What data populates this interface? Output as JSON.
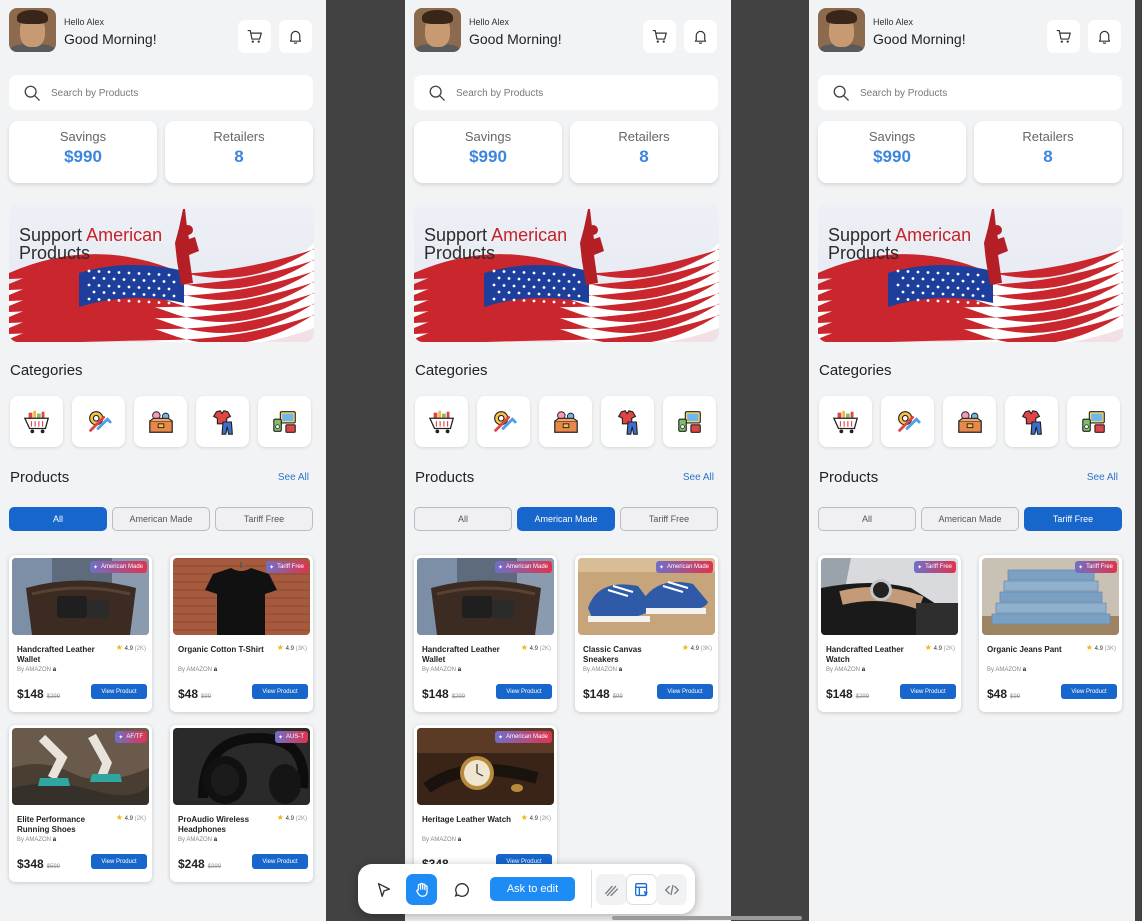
{
  "common": {
    "hello": "Hello Alex",
    "greeting": "Good Morning!",
    "search_placeholder": "Search by Products",
    "savings_label": "Savings",
    "savings_value": "$990",
    "retailers_label": "Retailers",
    "retailers_value": "8",
    "banner_line1_a": "Support ",
    "banner_line1_b": "American",
    "banner_line2": "Products",
    "categories_title": "Categories",
    "products_title": "Products",
    "see_all": "See All",
    "filters": [
      "All",
      "American Made",
      "Tariff Free"
    ],
    "view_product": "View Product",
    "by_label": "By AMAZON",
    "star": "★"
  },
  "categories": [
    {
      "icon": "grocery-cart-icon"
    },
    {
      "icon": "tools-icon"
    },
    {
      "icon": "toys-box-icon"
    },
    {
      "icon": "clothing-icon"
    },
    {
      "icon": "electronics-icon"
    }
  ],
  "screens": [
    {
      "active_filter": "All",
      "products": [
        {
          "name": "Handcrafted Leather Wallet",
          "badge": "American Made",
          "rating": "4.9",
          "count": "(2K)",
          "price": "$148",
          "old": "$299",
          "image": "bag"
        },
        {
          "name": "Organic Cotton T-Shirt",
          "badge": "Tariff Free",
          "rating": "4.9",
          "count": "(3K)",
          "price": "$48",
          "old": "$99",
          "image": "tshirt"
        },
        {
          "name": "Elite Performance Running Shoes",
          "badge": "AF/TF",
          "rating": "4.9",
          "count": "(2K)",
          "price": "$348",
          "old": "$599",
          "image": "running"
        },
        {
          "name": "ProAudio Wireless Headphones",
          "badge": "AUS-T",
          "rating": "4.9",
          "count": "(2K)",
          "price": "$248",
          "old": "$399",
          "image": "headphones"
        }
      ]
    },
    {
      "active_filter": "American Made",
      "products": [
        {
          "name": "Handcrafted Leather Wallet",
          "badge": "American Made",
          "rating": "4.9",
          "count": "(2K)",
          "price": "$148",
          "old": "$299",
          "image": "bag"
        },
        {
          "name": "Classic Canvas Sneakers",
          "badge": "American Made",
          "rating": "4.9",
          "count": "(3K)",
          "price": "$148",
          "old": "$99",
          "image": "sneakers"
        },
        {
          "name": "Heritage Leather Watch",
          "badge": "American Made",
          "rating": "4.9",
          "count": "(2K)",
          "price": "$348",
          "old": "",
          "image": "watch"
        }
      ]
    },
    {
      "active_filter": "Tariff Free",
      "products": [
        {
          "name": "Handcrafted Leather Watch",
          "badge": "Tariff Free",
          "rating": "4.9",
          "count": "(2K)",
          "price": "$148",
          "old": "$299",
          "image": "wristwatch"
        },
        {
          "name": "Organic Jeans Pant",
          "badge": "Tariff Free",
          "rating": "4.9",
          "count": "(3K)",
          "price": "$48",
          "old": "$99",
          "image": "jeans"
        }
      ]
    }
  ],
  "toolbar": {
    "ask_label": "Ask to edit",
    "tools": [
      "pointer-icon",
      "hand-icon",
      "comment-icon",
      "draw-icon",
      "layout-icon",
      "code-icon"
    ]
  },
  "colors": {
    "accent": "#1766cc",
    "stat_value": "#3c86df",
    "banner_red": "#c62229",
    "badge_gradient_start": "#6f6fc8",
    "badge_gradient_end": "#e0334e"
  }
}
